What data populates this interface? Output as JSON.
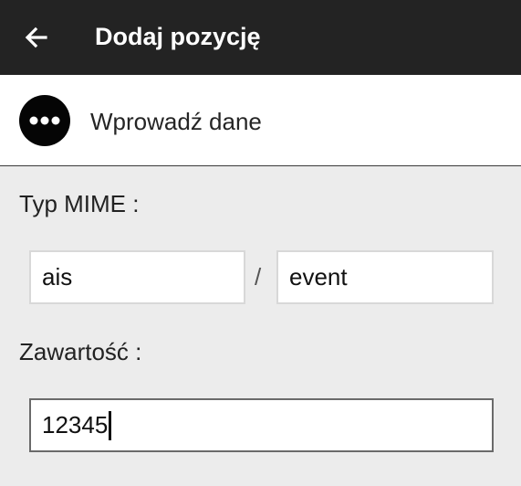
{
  "app_bar": {
    "back_icon": "arrow-left-icon",
    "title": "Dodaj pozycję"
  },
  "input_method": {
    "icon": "more-horizontal-icon",
    "label": "Wprowadź dane"
  },
  "form": {
    "mime_label": "Typ MIME :",
    "mime_type_value": "ais",
    "mime_separator": "/",
    "mime_subtype_value": "event",
    "content_label": "Zawartość :",
    "content_value": "12345"
  },
  "colors": {
    "app_bar": "#232323",
    "background": "#ececec",
    "card": "#ffffff",
    "text": "#1f1f1f"
  }
}
